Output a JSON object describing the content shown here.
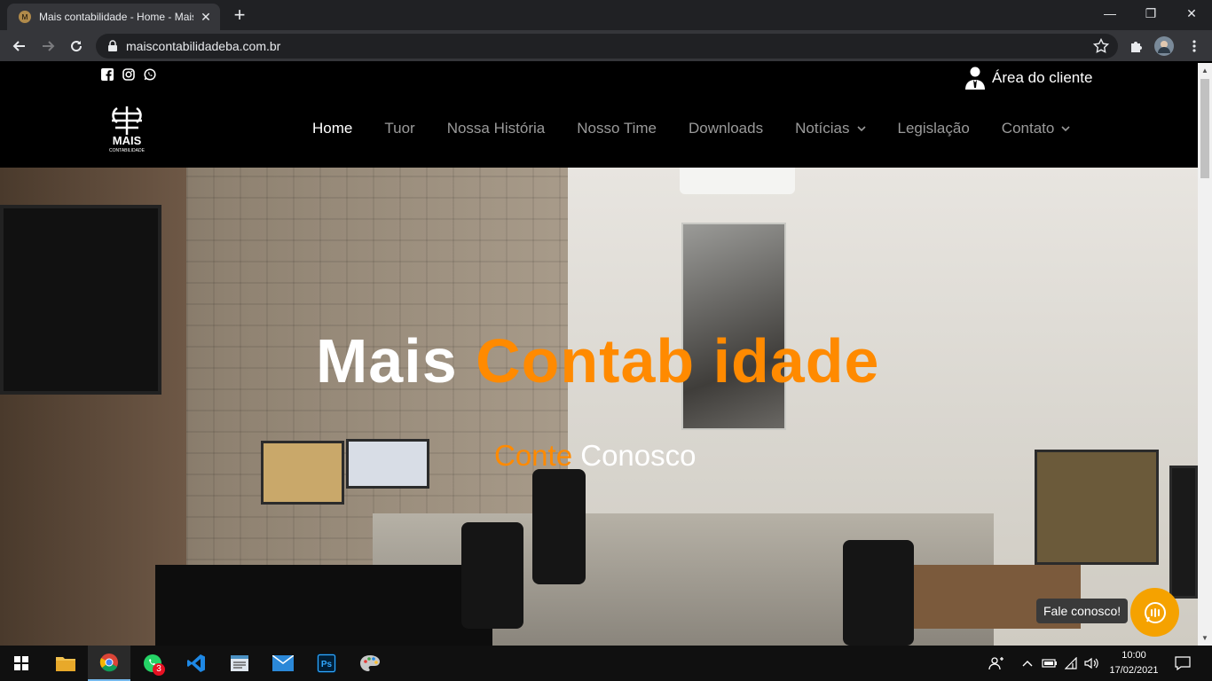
{
  "browser": {
    "tab_title": "Mais contabilidade - Home - Mais contabilidade",
    "url": "maiscontabilidadeba.com.br"
  },
  "site": {
    "client_area_label": "Área do cliente",
    "logo_text": "MAIS",
    "logo_subtext": "CONTABILIDADE",
    "nav": [
      {
        "label": "Home",
        "active": true,
        "dropdown": false
      },
      {
        "label": "Tuor",
        "active": false,
        "dropdown": false
      },
      {
        "label": "Nossa História",
        "active": false,
        "dropdown": false
      },
      {
        "label": "Nosso Time",
        "active": false,
        "dropdown": false
      },
      {
        "label": "Downloads",
        "active": false,
        "dropdown": false
      },
      {
        "label": "Notícias",
        "active": false,
        "dropdown": true
      },
      {
        "label": "Legislação",
        "active": false,
        "dropdown": false
      },
      {
        "label": "Contato",
        "active": false,
        "dropdown": true
      }
    ],
    "hero": {
      "title_white": "Mais ",
      "title_orange": "Contab  idade",
      "subtitle_orange": "Conte ",
      "subtitle_white": "Conosco"
    },
    "chat_label": "Fale conosco!",
    "accent_color": "#ff8a00"
  },
  "taskbar": {
    "whatsapp_badge": "3",
    "time": "10:00",
    "date": "17/02/2021"
  }
}
